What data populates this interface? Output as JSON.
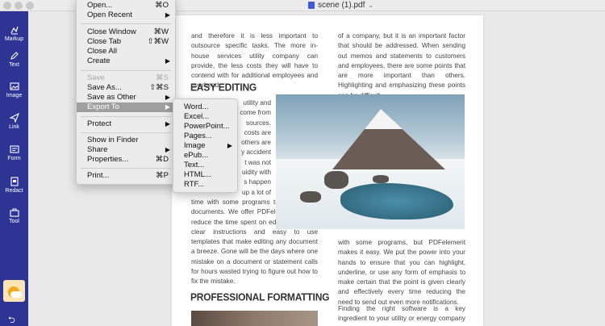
{
  "window": {
    "title": "scene (1).pdf"
  },
  "sidebar": {
    "items": [
      {
        "label": "Markup",
        "icon": "markup-icon"
      },
      {
        "label": "Text",
        "icon": "text-pen-icon"
      },
      {
        "label": "Image",
        "icon": "image-icon"
      },
      {
        "label": "Link",
        "icon": "link-send-icon"
      },
      {
        "label": "Form",
        "icon": "form-icon"
      },
      {
        "label": "Redact",
        "icon": "redact-icon"
      },
      {
        "label": "Tool",
        "icon": "toolbox-icon"
      }
    ],
    "accent": "#2d3494"
  },
  "file_menu": {
    "items": [
      {
        "label": "Open...",
        "shortcut": "⌘O"
      },
      {
        "label": "Open Recent",
        "submenu": true
      },
      {
        "label": "Close Window",
        "shortcut": "⌘W"
      },
      {
        "label": "Close Tab",
        "shortcut": "⇧⌘W"
      },
      {
        "label": "Close All"
      },
      {
        "label": "Create",
        "submenu": true
      },
      {
        "label": "Save",
        "shortcut": "⌘S",
        "disabled": true
      },
      {
        "label": "Save As...",
        "shortcut": "⇧⌘S"
      },
      {
        "label": "Save as Other",
        "submenu": true
      },
      {
        "label": "Export To",
        "submenu": true,
        "highlighted": true
      },
      {
        "label": "Protect",
        "submenu": true
      },
      {
        "label": "Show in Finder"
      },
      {
        "label": "Share",
        "submenu": true
      },
      {
        "label": "Properties...",
        "shortcut": "⌘D"
      },
      {
        "label": "Print...",
        "shortcut": "⌘P"
      }
    ]
  },
  "export_submenu": {
    "items": [
      {
        "label": "Word..."
      },
      {
        "label": "Excel..."
      },
      {
        "label": "PowerPoint..."
      },
      {
        "label": "Pages..."
      },
      {
        "label": "Image",
        "submenu": true
      },
      {
        "label": "ePub..."
      },
      {
        "label": "Text..."
      },
      {
        "label": "HTML..."
      },
      {
        "label": "RTF..."
      }
    ]
  },
  "document": {
    "left_col_top": "and therefore it is less important to outsource specific tasks. The more in-house services utility company can provide, the less costs they will have to contend with for additional employees and overhead.",
    "heading1": "EASY EDITING",
    "left_col_fragments": [
      "utility and",
      "come from",
      "sources.",
      "costs are",
      "others are",
      "y accident",
      "t was not",
      "uidity with",
      "s happen",
      "up a lot of"
    ],
    "left_col_bottom": "time with some programs to fix and edit documents. We offer PDFelement to help reduce the time spent on editing. We offer clear instructions and easy to use templates that make editing any document a breeze. Gone will be the days where one mistake on a document or statement calls for hours wasted trying to figure out how to fix the mistake.",
    "heading2": "PROFESSIONAL FORMATTING",
    "right_col_top": "of a company, but it is an important factor that should be addressed. When sending out memos and statements to customers and employees, there are some points that are more important than others. Highlighting and emphasizing these points can be difficult",
    "right_col_bottom": "with some programs, but PDFelement makes it easy. We put the power into your hands to ensure that you can highlight, underline, or use any form of emphasis to make certain that the point is given clearly and effectively every time reducing the need to send out even more notifications.",
    "right_col_last": "Finding the right software is a key ingredient to your utility or energy company remains"
  }
}
